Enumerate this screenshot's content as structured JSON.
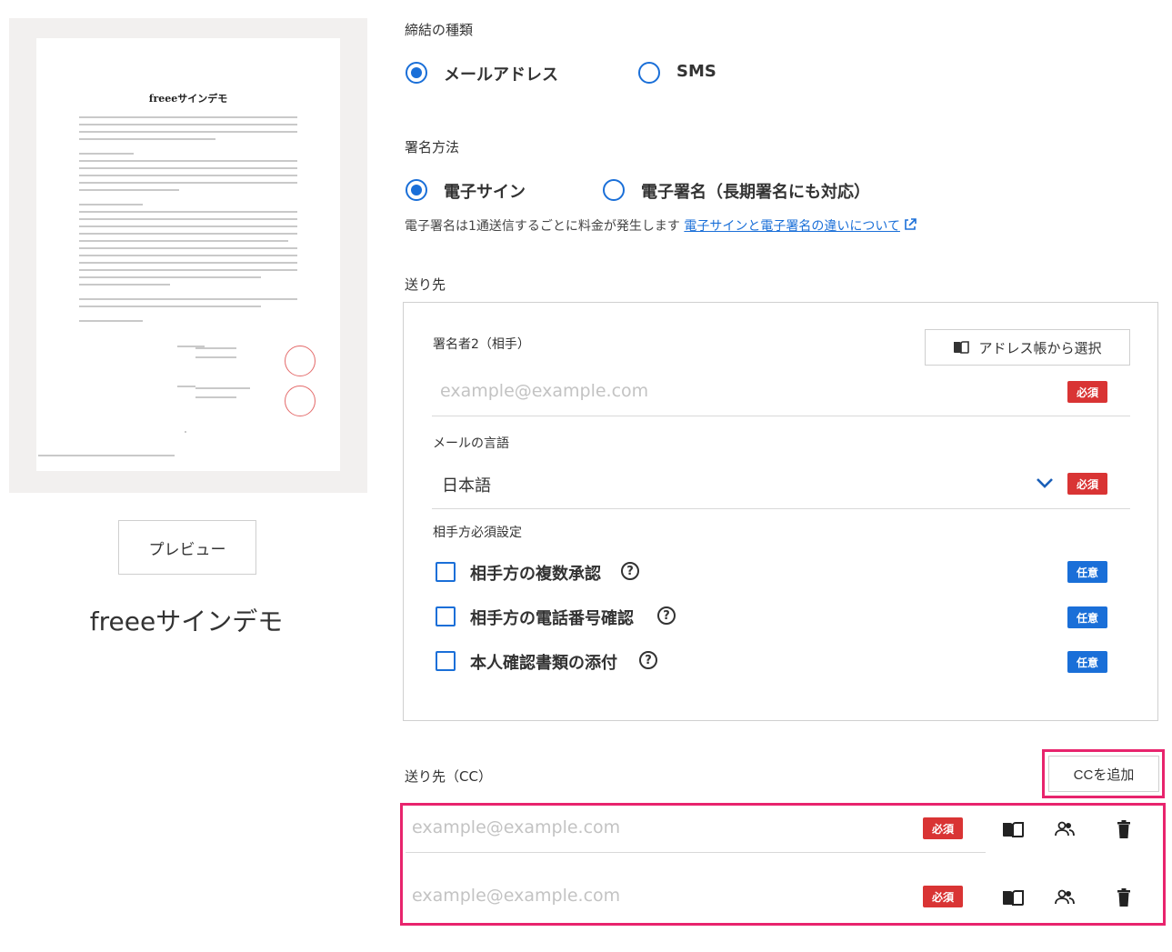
{
  "preview": {
    "doc_title": "freeeサインデモ",
    "button_label": "プレビュー",
    "doc_name": "freeeサインデモ"
  },
  "conclusion": {
    "label": "締結の種類",
    "options": [
      {
        "label": "メールアドレス",
        "selected": true
      },
      {
        "label": "SMS",
        "selected": false
      }
    ]
  },
  "signature_method": {
    "label": "署名方法",
    "options": [
      {
        "label": "電子サイン",
        "selected": true
      },
      {
        "label": "電子署名（長期署名にも対応）",
        "selected": false
      }
    ],
    "note": "電子署名は1通送信するごとに料金が発生します",
    "link": "電子サインと電子署名の違いについて"
  },
  "recipient": {
    "section_label": "送り先",
    "signer_label": "署名者2（相手）",
    "address_book_button": "アドレス帳から選択",
    "email_placeholder": "example@example.com",
    "required_badge": "必須",
    "language_label": "メールの言語",
    "language_value": "日本語",
    "party_settings_label": "相手方必須設定",
    "optional_badge": "任意",
    "checkboxes": [
      {
        "label": "相手方の複数承認",
        "checked": false
      },
      {
        "label": "相手方の電話番号確認",
        "checked": false
      },
      {
        "label": "本人確認書類の添付",
        "checked": false
      }
    ]
  },
  "cc": {
    "label": "送り先（CC）",
    "add_button": "CCを追加",
    "rows": [
      {
        "placeholder": "example@example.com",
        "badge": "必須"
      },
      {
        "placeholder": "example@example.com",
        "badge": "必須"
      }
    ]
  },
  "colors": {
    "accent": "#1a6fd8",
    "required": "#d93434",
    "highlight": "#e8246d"
  }
}
